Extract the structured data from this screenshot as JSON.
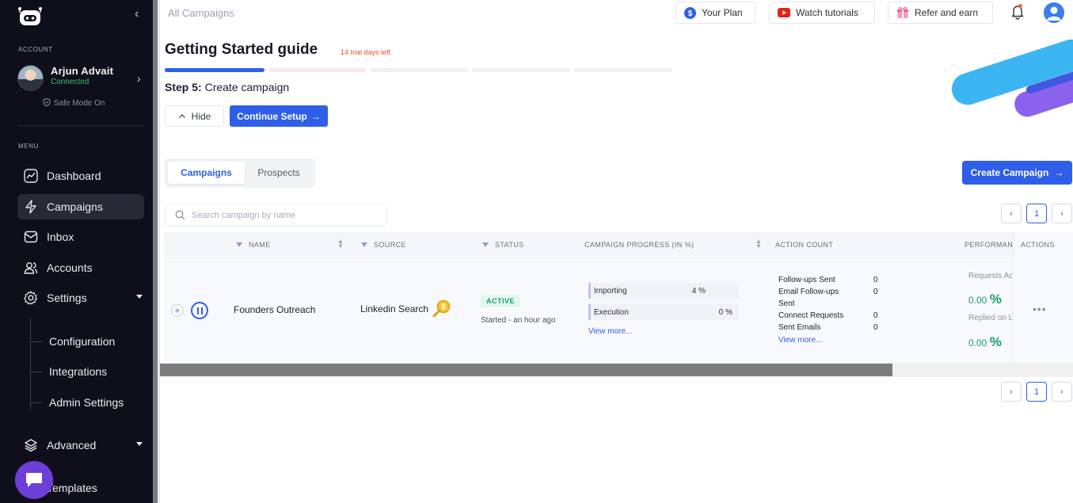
{
  "sidebar": {
    "account_label": "ACCOUNT",
    "user": {
      "name": "Arjun Advait",
      "status": "Connected",
      "safe_mode": "Safe Mode On"
    },
    "menu_label": "MENU",
    "items": [
      {
        "label": "Dashboard",
        "icon": "dashboard-icon"
      },
      {
        "label": "Campaigns",
        "icon": "campaigns-icon",
        "active": true
      },
      {
        "label": "Inbox",
        "icon": "inbox-icon"
      },
      {
        "label": "Accounts",
        "icon": "accounts-icon"
      },
      {
        "label": "Settings",
        "icon": "settings-icon"
      }
    ],
    "settings_sub": [
      "Configuration",
      "Integrations",
      "Admin Settings"
    ],
    "advanced": "Advanced",
    "templates": "Templates"
  },
  "header": {
    "breadcrumb": "All Campaigns",
    "your_plan": "Your Plan",
    "watch_tutorials": "Watch tutorials",
    "refer_and_earn": "Refer and earn"
  },
  "guide": {
    "title": "Getting Started guide",
    "trial": "14 trial days left",
    "step_prefix": "Step 5:",
    "step_text": "Create campaign",
    "hide": "Hide",
    "continue": "Continue Setup",
    "completed_segments": 1,
    "total_segments": 5
  },
  "tabs": {
    "campaigns": "Campaigns",
    "prospects": "Prospects"
  },
  "create_campaign": "Create Campaign",
  "search": {
    "placeholder": "Search campaign by name"
  },
  "pagination": {
    "page": "1"
  },
  "table": {
    "headers": {
      "name": "NAME",
      "source": "SOURCE",
      "status": "STATUS",
      "progress": "CAMPAIGN PROGRESS (IN %)",
      "action_count": "ACTION COUNT",
      "performance": "PERFORMANCE",
      "actions": "ACTIONS"
    },
    "row": {
      "name": "Founders Outreach",
      "source": "Linkedin Search",
      "status": "ACTIVE",
      "started": "Started - an hour ago",
      "progress": [
        {
          "label": "Importing",
          "value": "4 %"
        },
        {
          "label": "Execution",
          "value": "0 %"
        }
      ],
      "progress_view_more": "View more...",
      "action_counts": [
        {
          "label": "Follow-ups Sent",
          "value": "0"
        },
        {
          "label": "Email Follow-ups",
          "label2": "Sent",
          "value": "0"
        },
        {
          "label": "Connect Requests",
          "value": "0"
        },
        {
          "label": "Sent Emails",
          "value": "0"
        }
      ],
      "actions_view_more": "View more...",
      "performance": [
        {
          "label": "Requests Ac",
          "value": "0.00",
          "unit": "%"
        },
        {
          "label": "Replied on L",
          "value": "0.00",
          "unit": "%"
        }
      ]
    }
  },
  "colors": {
    "accent": "#2f5fe8",
    "sidebar_bg": "#0e0f1a",
    "active_green": "#1aa36b"
  }
}
